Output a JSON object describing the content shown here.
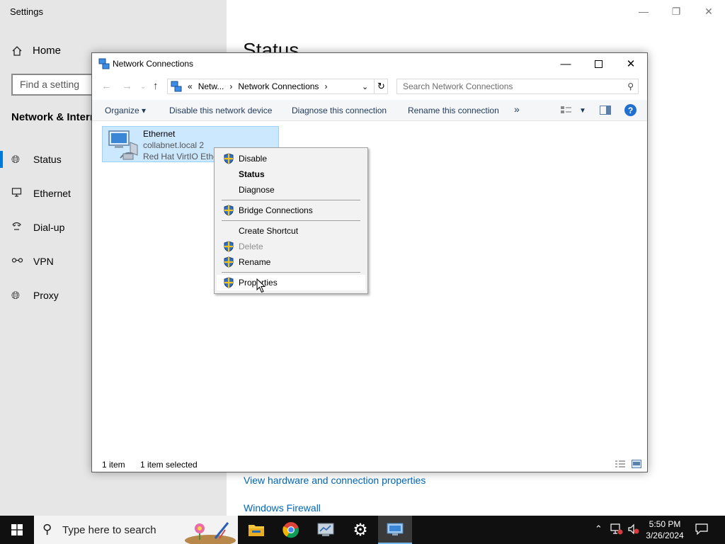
{
  "settings": {
    "title": "Settings",
    "home": "Home",
    "search_placeholder": "Find a setting",
    "section": "Network & Internet",
    "nav": [
      {
        "label": "Status",
        "icon": "globe-icon"
      },
      {
        "label": "Ethernet",
        "icon": "monitor-icon"
      },
      {
        "label": "Dial-up",
        "icon": "phone-icon"
      },
      {
        "label": "VPN",
        "icon": "vpn-icon"
      },
      {
        "label": "Proxy",
        "icon": "globe-icon"
      }
    ],
    "heading": "Status",
    "links": [
      "View hardware and connection properties",
      "Windows Firewall"
    ]
  },
  "network": {
    "title": "Network Connections",
    "breadcrumb": [
      "«",
      "Netw...",
      "Network Connections"
    ],
    "search_placeholder": "Search Network Connections",
    "commands": {
      "organize": "Organize",
      "disable": "Disable this network device",
      "diagnose": "Diagnose this connection",
      "rename": "Rename this connection",
      "more": "»"
    },
    "item": {
      "name": "Ethernet",
      "network": "collabnet.local 2",
      "adapter": "Red Hat VirtIO Ethe..."
    },
    "status": {
      "count": "1 item",
      "selected": "1 item selected"
    }
  },
  "context_menu": {
    "items": [
      "Disable",
      "Status",
      "Diagnose",
      "Bridge Connections",
      "Create Shortcut",
      "Delete",
      "Rename",
      "Properties"
    ]
  },
  "taskbar": {
    "search_placeholder": "Type here to search",
    "time": "5:50 PM",
    "date": "3/26/2024"
  }
}
